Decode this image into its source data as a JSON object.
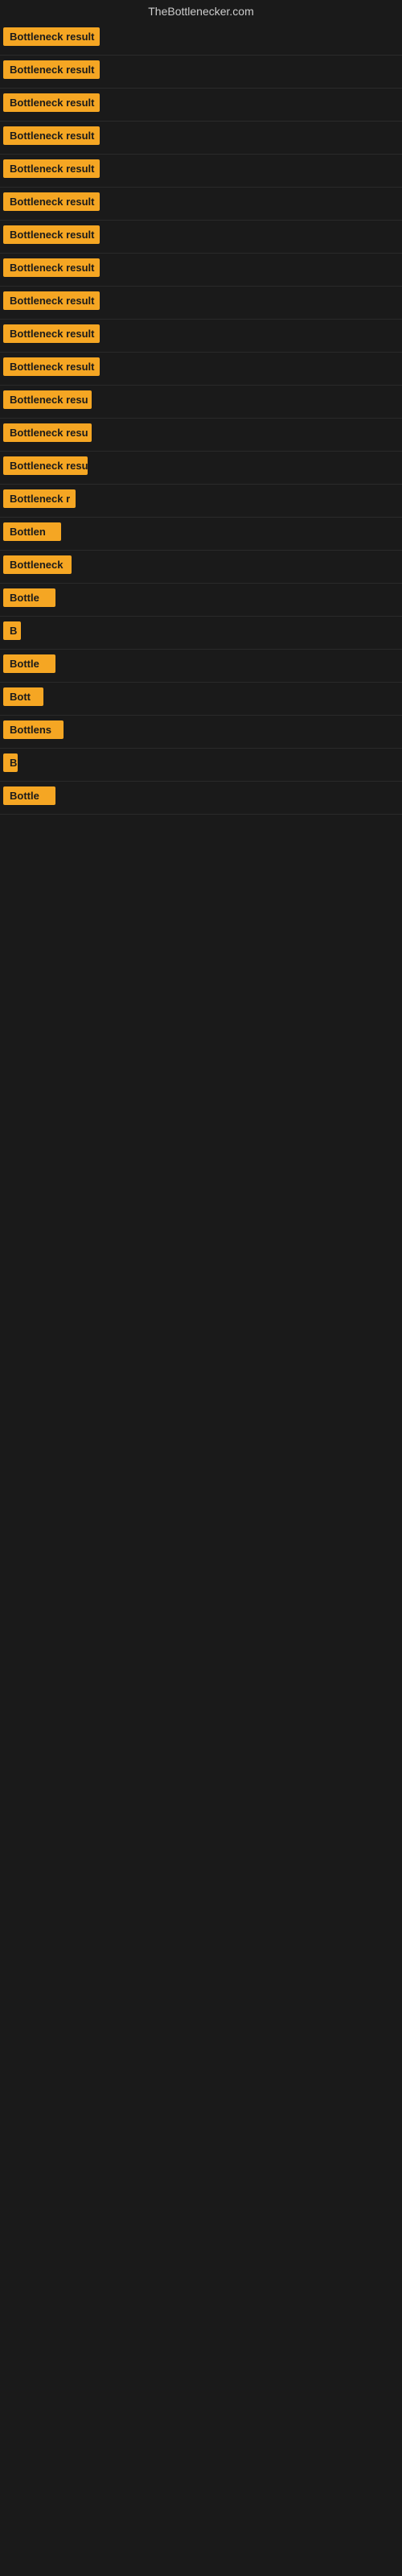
{
  "header": {
    "title": "TheBottlenecker.com"
  },
  "badges": [
    {
      "id": 1,
      "label": "Bottleneck result",
      "width": 120
    },
    {
      "id": 2,
      "label": "Bottleneck result",
      "width": 120
    },
    {
      "id": 3,
      "label": "Bottleneck result",
      "width": 120
    },
    {
      "id": 4,
      "label": "Bottleneck result",
      "width": 120
    },
    {
      "id": 5,
      "label": "Bottleneck result",
      "width": 120
    },
    {
      "id": 6,
      "label": "Bottleneck result",
      "width": 120
    },
    {
      "id": 7,
      "label": "Bottleneck result",
      "width": 120
    },
    {
      "id": 8,
      "label": "Bottleneck result",
      "width": 120
    },
    {
      "id": 9,
      "label": "Bottleneck result",
      "width": 120
    },
    {
      "id": 10,
      "label": "Bottleneck result",
      "width": 120
    },
    {
      "id": 11,
      "label": "Bottleneck result",
      "width": 120
    },
    {
      "id": 12,
      "label": "Bottleneck resu",
      "width": 110
    },
    {
      "id": 13,
      "label": "Bottleneck resu",
      "width": 110
    },
    {
      "id": 14,
      "label": "Bottleneck resu",
      "width": 105
    },
    {
      "id": 15,
      "label": "Bottleneck r",
      "width": 90
    },
    {
      "id": 16,
      "label": "Bottlen",
      "width": 72
    },
    {
      "id": 17,
      "label": "Bottleneck",
      "width": 85
    },
    {
      "id": 18,
      "label": "Bottle",
      "width": 65
    },
    {
      "id": 19,
      "label": "B",
      "width": 22
    },
    {
      "id": 20,
      "label": "Bottle",
      "width": 65
    },
    {
      "id": 21,
      "label": "Bott",
      "width": 50
    },
    {
      "id": 22,
      "label": "Bottlens",
      "width": 75
    },
    {
      "id": 23,
      "label": "B",
      "width": 18
    },
    {
      "id": 24,
      "label": "Bottle",
      "width": 65
    }
  ]
}
